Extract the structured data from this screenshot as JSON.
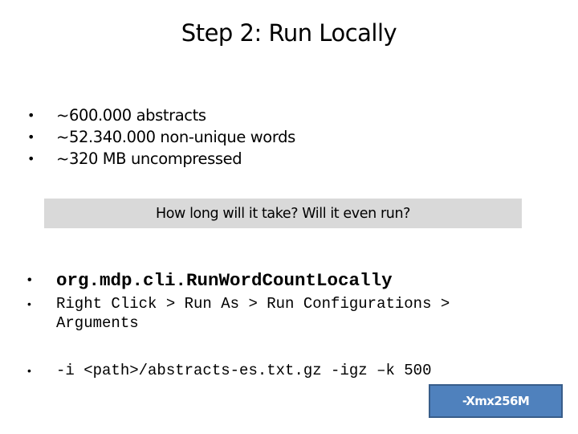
{
  "slide": {
    "title": "Step 2: Run Locally",
    "stats": [
      {
        "bullet": "•",
        "text": "~600.000 abstracts"
      },
      {
        "bullet": "•",
        "text": "~52.340.000 non-unique words"
      },
      {
        "bullet": "•",
        "text": "~320 MB uncompressed"
      }
    ],
    "callout": "How long will it take? Will it even run?",
    "main_class": {
      "bullet": "•",
      "text": "org.mdp.cli.RunWordCountLocally"
    },
    "run_path": {
      "bullet": "•",
      "text": "Right Click > Run As > Run Configurations > Arguments"
    },
    "arguments": {
      "bullet": "•",
      "text": "-i <path>/abstracts-es.txt.gz -igz –k 500"
    },
    "vm_option": "-Xmx256M",
    "colors": {
      "callout_bg": "#d9d9d9",
      "vm_box_fill": "#4f81bd",
      "vm_box_border": "#385d8a",
      "vm_box_text": "#ffffff"
    }
  }
}
